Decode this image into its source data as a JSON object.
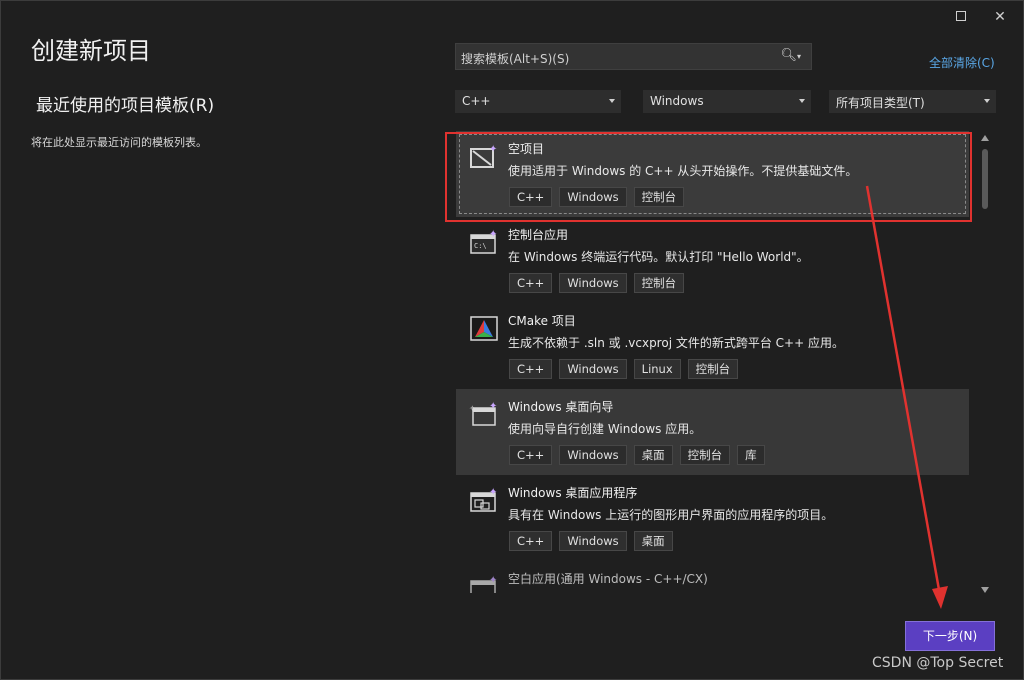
{
  "window": {
    "maximize_icon": "maximize-icon",
    "close_symbol": "✕"
  },
  "header": {
    "title": "创建新项目"
  },
  "recent": {
    "title": "最近使用的项目模板(R)",
    "empty_text": "将在此处显示最近访问的模板列表。"
  },
  "search": {
    "placeholder": "搜索模板(Alt+S)(S)",
    "icon": "search-icon"
  },
  "clear_all": "全部清除(C)",
  "filters": {
    "language": "C++",
    "platform": "Windows",
    "project_type": "所有项目类型(T)"
  },
  "templates": [
    {
      "title": "空项目",
      "description": "使用适用于 Windows 的 C++ 从头开始操作。不提供基础文件。",
      "tags": [
        "C++",
        "Windows",
        "控制台"
      ]
    },
    {
      "title": "控制台应用",
      "description": "在 Windows 终端运行代码。默认打印 \"Hello World\"。",
      "tags": [
        "C++",
        "Windows",
        "控制台"
      ]
    },
    {
      "title": "CMake 项目",
      "description": "生成不依赖于 .sln 或 .vcxproj 文件的新式跨平台 C++ 应用。",
      "tags": [
        "C++",
        "Windows",
        "Linux",
        "控制台"
      ]
    },
    {
      "title": "Windows 桌面向导",
      "description": "使用向导自行创建 Windows 应用。",
      "tags": [
        "C++",
        "Windows",
        "桌面",
        "控制台",
        "库"
      ]
    },
    {
      "title": "Windows 桌面应用程序",
      "description": "具有在 Windows 上运行的图形用户界面的应用程序的项目。",
      "tags": [
        "C++",
        "Windows",
        "桌面"
      ]
    },
    {
      "title": "空白应用(通用 Windows - C++/CX)",
      "description": "",
      "tags": []
    }
  ],
  "next_button": "下一步(N)",
  "watermark": "CSDN @Top Secret",
  "colors": {
    "accent": "#5b3fc2",
    "highlight": "#e0322f",
    "link": "#5aa7e6"
  }
}
